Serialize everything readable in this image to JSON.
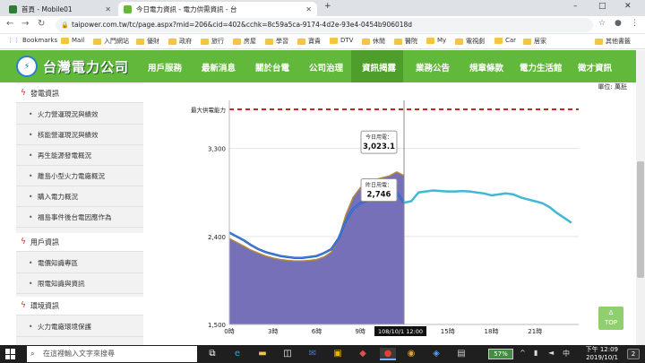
{
  "browser": {
    "tabs": [
      {
        "title": "首頁 - Mobile01",
        "active": false
      },
      {
        "title": "今日電力資訊 - 電力供需資訊 - 台",
        "active": true
      }
    ],
    "new_tab": "+",
    "window_controls": [
      "–",
      "□",
      "✕"
    ],
    "url": "taipower.com.tw/tc/page.aspx?mid=206&cid=402&cchk=8c59a5ca-9174-4d2e-93e4-0454b906018d",
    "bookmarks": [
      "Bookmarks",
      "Mail",
      "入門網站",
      "優財",
      "政府",
      "旅行",
      "房屋",
      "學習",
      "寶貴",
      "DTV",
      "休閒",
      "醫院",
      "My",
      "電視劇",
      "Car",
      "居家"
    ],
    "other_bookmarks": "其他書籤"
  },
  "site": {
    "logo_text": "台灣電力公司",
    "nav": [
      "用戶服務",
      "最新消息",
      "關於台電",
      "公司治理",
      "資訊揭露",
      "業務公告",
      "規章條款",
      "電力生活館",
      "徵才資訊"
    ],
    "nav_active_index": 4
  },
  "sidebar": {
    "sections": [
      {
        "title": "發電資訊",
        "items": [
          "火力營運現況與績效",
          "核能營運現況與績效",
          "再生能源發電概況",
          "離島小型火力電廠概況",
          "購入電力概況",
          "福島事件後台電因應作為"
        ]
      },
      {
        "title": "用戶資訊",
        "items": [
          "電價知識專區",
          "限電知識與資訊"
        ]
      },
      {
        "title": "環境資訊",
        "items": [
          "火力電廠環境保護"
        ]
      }
    ]
  },
  "main": {
    "unit_label": "單位: 萬瓩",
    "top_button": [
      "Δ",
      "TOP"
    ]
  },
  "chart_data": {
    "type": "area",
    "max_supply_label": "最大供電能力",
    "max_supply_value": 3700,
    "y_ticks": [
      1500,
      2400,
      3300
    ],
    "y_tick_labels": [
      "1,500",
      "2,400",
      "3,300"
    ],
    "ylim": [
      1500,
      3700
    ],
    "x_ticks": [
      0,
      3,
      6,
      9,
      15,
      18,
      21
    ],
    "x_tick_labels": [
      "0時",
      "3時",
      "6時",
      "9時",
      "15時",
      "18時",
      "21時"
    ],
    "xlim": [
      0,
      24
    ],
    "cursor_x": 12,
    "cursor_label": "108/10/1 12:00",
    "tooltip_today": {
      "label": "今日用電：",
      "value": "3,023.1"
    },
    "tooltip_yesterday": {
      "label": "昨日用電：",
      "value": "2,746"
    },
    "series": [
      {
        "name": "今日用電",
        "x": [
          0,
          0.5,
          1,
          1.5,
          2,
          2.5,
          3,
          3.5,
          4,
          4.5,
          5,
          5.5,
          6,
          6.5,
          7,
          7.5,
          8,
          8.5,
          9,
          9.5,
          10,
          10.5,
          11,
          11.5,
          12
        ],
        "values": [
          2380,
          2340,
          2300,
          2260,
          2230,
          2200,
          2180,
          2165,
          2155,
          2150,
          2150,
          2155,
          2165,
          2190,
          2240,
          2370,
          2620,
          2800,
          2900,
          2950,
          2980,
          3000,
          3020,
          3060,
          3023
        ]
      },
      {
        "name": "昨日用電",
        "x": [
          0,
          0.5,
          1,
          1.5,
          2,
          2.5,
          3,
          3.5,
          4,
          4.5,
          5,
          5.5,
          6,
          6.5,
          7,
          7.5,
          8,
          8.5,
          9,
          9.5,
          10,
          10.5,
          11,
          11.5,
          12,
          12.5,
          13,
          13.5,
          14,
          14.5,
          15,
          15.5,
          16,
          16.5,
          17,
          17.5,
          18,
          18.5,
          19,
          19.5,
          20,
          20.5,
          21,
          21.5,
          22,
          22.5,
          23,
          23.5
        ],
        "values": [
          2440,
          2400,
          2360,
          2310,
          2270,
          2240,
          2220,
          2200,
          2190,
          2180,
          2180,
          2190,
          2200,
          2230,
          2270,
          2380,
          2560,
          2680,
          2740,
          2770,
          2790,
          2810,
          2830,
          2850,
          2746,
          2760,
          2850,
          2860,
          2870,
          2865,
          2860,
          2860,
          2865,
          2860,
          2850,
          2840,
          2820,
          2830,
          2840,
          2830,
          2800,
          2780,
          2760,
          2740,
          2700,
          2640,
          2590,
          2540
        ]
      }
    ],
    "colors": {
      "today_fill": "#6f68b5",
      "today_edge": "#b58a3a",
      "yesterday_line": "#43b8d4",
      "yesterday_dark": "#2d55c8",
      "max_line": "#cc2222"
    }
  },
  "taskbar": {
    "search_placeholder": "在這裡輸入文字來搜尋",
    "battery": "57%",
    "time": "下午 12:09",
    "date": "2019/10/1",
    "notification_count": "2"
  }
}
